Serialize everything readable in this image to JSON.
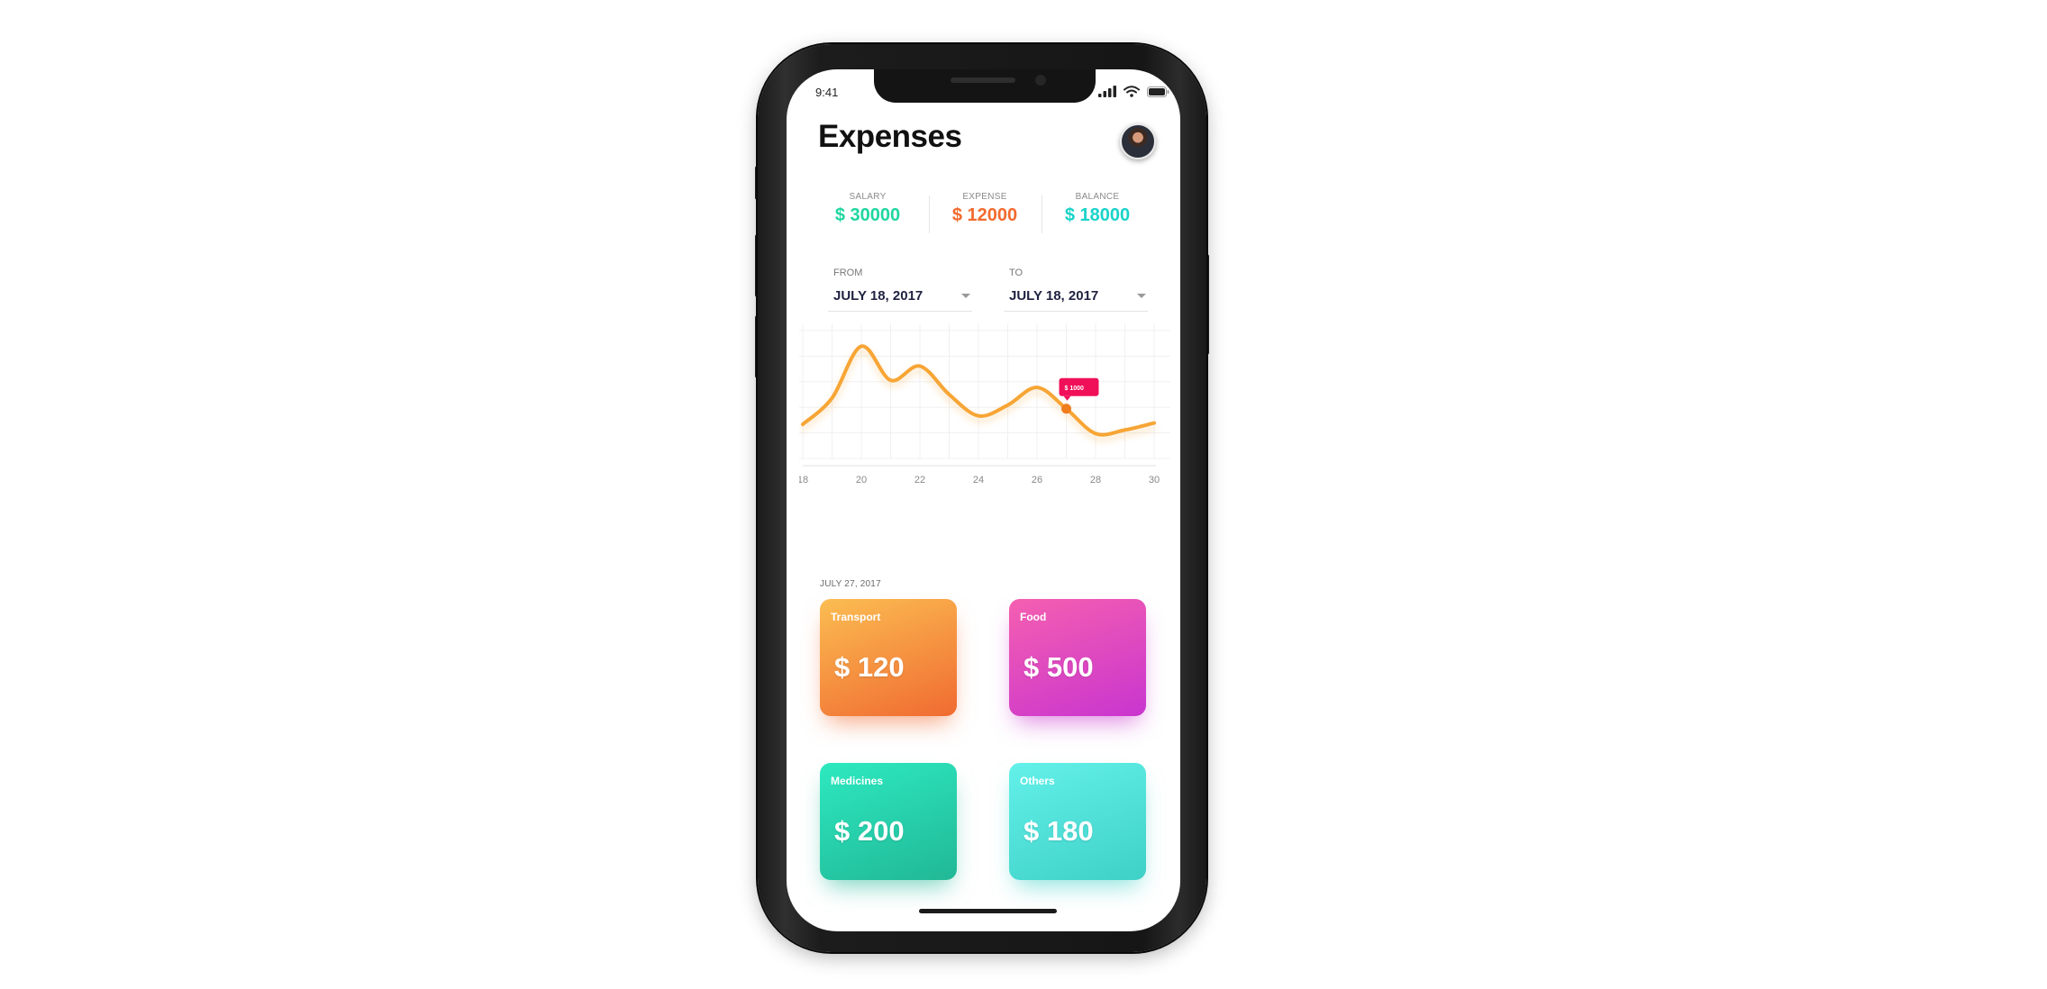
{
  "status_bar": {
    "time": "9:41",
    "icons": [
      "signal-icon",
      "wifi-icon",
      "battery-icon"
    ]
  },
  "header": {
    "title": "Expenses",
    "avatar": "user-avatar"
  },
  "summary": [
    {
      "label": "SALARY",
      "value": "$ 30000",
      "color": "#1fd6a0"
    },
    {
      "label": "EXPENSE",
      "value": "$ 12000",
      "color": "#f26a2e"
    },
    {
      "label": "BALANCE",
      "value": "$ 18000",
      "color": "#19d3c9"
    }
  ],
  "date_range": {
    "from_label": "FROM",
    "from_value": "JULY 18, 2017",
    "to_label": "TO",
    "to_value": "JULY 18, 2017"
  },
  "chart_data": {
    "type": "line",
    "x": [
      18,
      19,
      20,
      21,
      22,
      23,
      24,
      25,
      26,
      27,
      28,
      29,
      30
    ],
    "values": [
      480,
      850,
      1580,
      1100,
      1300,
      900,
      600,
      750,
      1000,
      700,
      350,
      400,
      500
    ],
    "x_tick_labels": [
      "18",
      "20",
      "22",
      "24",
      "26",
      "28",
      "30"
    ],
    "highlight": {
      "x": 27,
      "label": "$ 1000"
    },
    "colors": {
      "line": "#f7a535",
      "marker": "#f07d1e",
      "tooltip": "#f0105a"
    },
    "grid": true
  },
  "details": {
    "date": "JULY 27, 2017",
    "categories": [
      {
        "label": "Transport",
        "value": "$ 120",
        "color_from": "#fbbd52",
        "color_to": "#f06b31"
      },
      {
        "label": "Food",
        "value": "$ 500",
        "color_from": "#f55fb0",
        "color_to": "#c935cf"
      },
      {
        "label": "Medicines",
        "value": "$ 200",
        "color_from": "#2de9c0",
        "color_to": "#21b896"
      },
      {
        "label": "Others",
        "value": "$ 180",
        "color_from": "#63f1ea",
        "color_to": "#3ed0c7"
      }
    ]
  }
}
